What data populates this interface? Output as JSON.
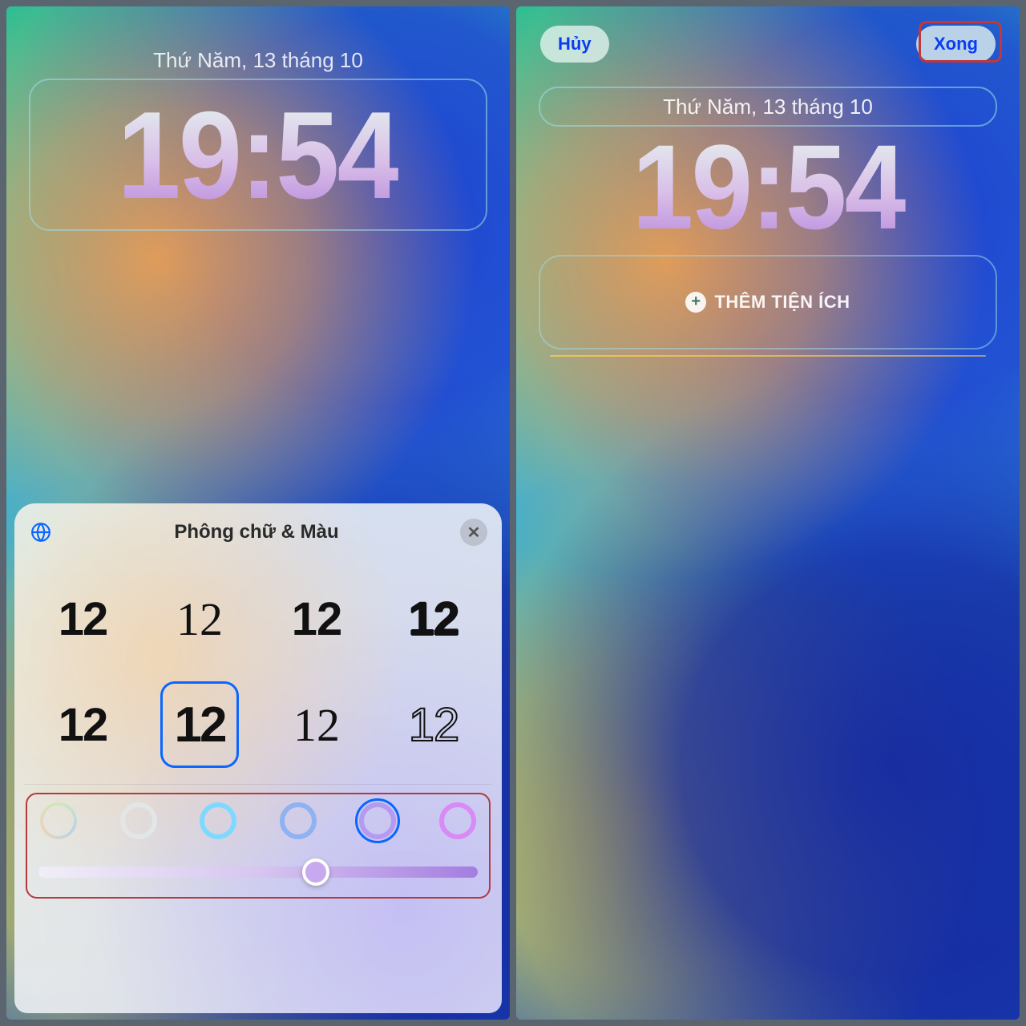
{
  "left": {
    "date": "Thứ Năm, 13 tháng 10",
    "time": "19:54",
    "sheet": {
      "title": "Phông chữ & Màu",
      "sample": "12",
      "selected_font_index": 5,
      "colors": [
        {
          "css": "conic"
        },
        {
          "css": "#e6e9ea"
        },
        {
          "css": "#7fd9ff"
        },
        {
          "css": "#8fb2f1"
        },
        {
          "css": "#b59af0"
        },
        {
          "css": "#d98af5"
        }
      ],
      "selected_color_index": 4,
      "slider_percent": 63
    }
  },
  "right": {
    "cancel": "Hủy",
    "done": "Xong",
    "date": "Thứ Năm, 13 tháng 10",
    "time": "19:54",
    "add_widgets": "THÊM TIỆN ÍCH"
  }
}
